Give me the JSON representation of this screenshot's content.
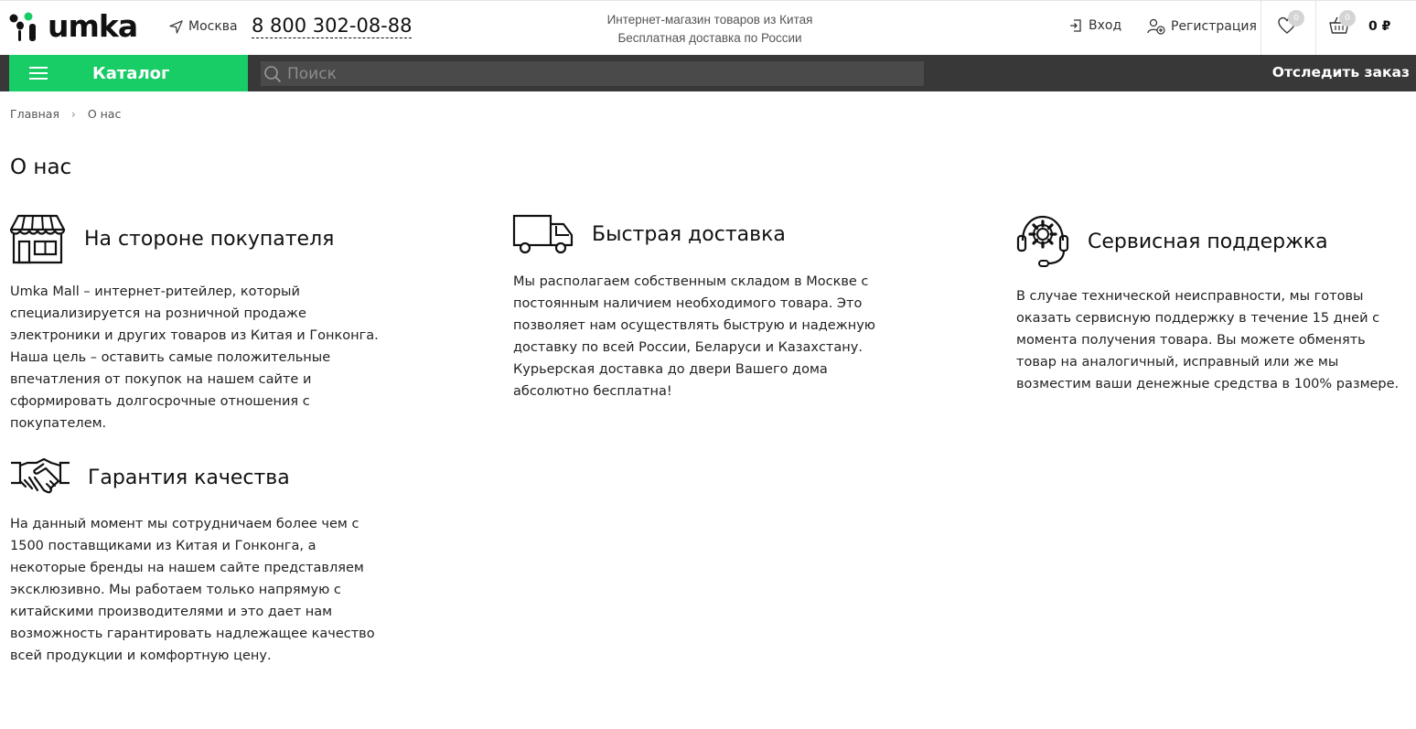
{
  "header": {
    "logo_text": "umka",
    "city": "Москва",
    "phone": "8 800 302-08-88",
    "tagline_line1": "Интернет-магазин товаров из Китая",
    "tagline_line2": "Бесплатная доставка по России",
    "login_label": "Вход",
    "register_label": "Регистрация",
    "favorites_count": "0",
    "cart_count": "0",
    "cart_sum": "0 ₽"
  },
  "navbar": {
    "catalog_label": "Каталог",
    "search_placeholder": "Поиск",
    "track_label": "Отследить заказ"
  },
  "breadcrumb": {
    "home": "Главная",
    "separator": "›",
    "current": "О нас"
  },
  "page": {
    "title": "О нас"
  },
  "features": {
    "buyer": {
      "icon": "storefront-icon",
      "title": "На стороне покупателя",
      "text": "Umka Mall – интернет-ритейлер, который специализируется на розничной продаже электроники и других товаров из Китая и Гонконга. Наша цель – оставить самые положительные впечатления от покупок на нашем сайте и сформировать долгосрочные отношения с покупателем."
    },
    "delivery": {
      "icon": "truck-icon",
      "title": "Быстрая доставка",
      "text": "Мы располагаем собственным складом в Москве с постоянным наличием необходимого товара. Это позволяет нам осуществлять быструю и надежную доставку по всей России, Беларуси и Казахстану. Курьерская доставка до двери Вашего дома абсолютно бесплатна!"
    },
    "support": {
      "icon": "service-headset-icon",
      "title": "Сервисная поддержка",
      "text": "В случае технической неисправности, мы готовы оказать сервисную поддержку в течение 15 дней с момента получения товара. Вы можете обменять товар на аналогичный, исправный или же мы возместим ваши денежные средства в 100% размере."
    },
    "quality": {
      "icon": "handshake-icon",
      "title": "Гарантия качества",
      "text": "На данный момент мы сотрудничаем более чем с 1500 поставщиками из Китая и Гонконга, а некоторые бренды на нашем сайте представляем эксклюзивно. Мы работаем только напрямую с китайскими производителями и это дает нам возможность гарантировать надлежащее качество всей продукции и комфортную цену."
    }
  },
  "colors": {
    "accent_green": "#18cc66",
    "nav_dark": "#383838"
  }
}
